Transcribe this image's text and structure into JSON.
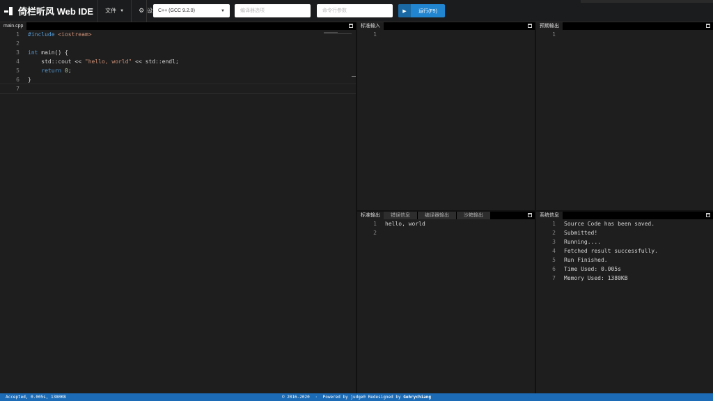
{
  "app": {
    "title": "倚栏听风 Web IDE"
  },
  "menu": {
    "file_label": "文件",
    "settings_label": "设置"
  },
  "toolbar": {
    "language": "C++ (GCC 9.2.0)",
    "compiler_options_placeholder": "编译器选项",
    "cli_args_placeholder": "命令行参数",
    "run_label": "运行(F9)"
  },
  "editor": {
    "tab": "main.cpp",
    "lines": [
      [
        {
          "t": "#include ",
          "c": "pre"
        },
        {
          "t": "<iostream>",
          "c": "hdr"
        }
      ],
      [],
      [
        {
          "t": "int",
          "c": "kw"
        },
        {
          "t": " main() {",
          "c": ""
        }
      ],
      [
        {
          "t": "    std::cout << ",
          "c": ""
        },
        {
          "t": "\"hello, world\"",
          "c": "str"
        },
        {
          "t": " << std::endl;",
          "c": ""
        }
      ],
      [
        {
          "t": "    ",
          "c": ""
        },
        {
          "t": "return",
          "c": "kw"
        },
        {
          "t": " ",
          "c": ""
        },
        {
          "t": "0",
          "c": "num"
        },
        {
          "t": ";",
          "c": ""
        }
      ],
      [
        {
          "t": "}",
          "c": ""
        }
      ],
      []
    ]
  },
  "stdin_panel": {
    "tab": "标准输入",
    "lines": [
      ""
    ]
  },
  "expected_panel": {
    "tab": "预期输出",
    "lines": [
      ""
    ]
  },
  "output_panel": {
    "tabs": [
      "标准输出",
      "错误信息",
      "编译器输出",
      "沙箱输出"
    ],
    "lines": [
      "hello, world",
      ""
    ]
  },
  "system_panel": {
    "tab": "系统信息",
    "lines": [
      "Source Code has been saved.",
      "Submitted!",
      "Running....",
      "Fetched result successfully.",
      "Run Finished.",
      "Time Used: 0.005s",
      "Memory Used: 1380KB"
    ]
  },
  "footer": {
    "status": "Accepted, 0.005s, 1380KB",
    "copyright": "© 2016-2020",
    "separator": "·",
    "powered": "Powered by judge0 Redesigned by",
    "author": "Gehrychiang"
  },
  "colors": {
    "accent": "#2185d0",
    "footer": "#1b6bb6",
    "keyword": "#569cd6",
    "string": "#ce9178",
    "number": "#b5cea8"
  }
}
